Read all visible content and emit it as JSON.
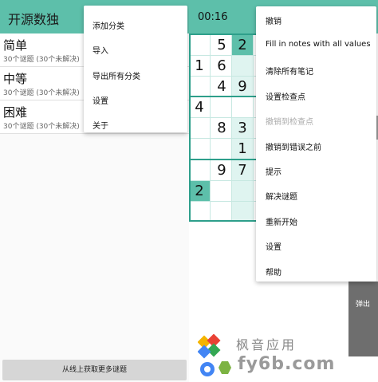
{
  "left_panel": {
    "title": "开源数独",
    "categories": [
      {
        "name": "简单",
        "sub": "30个谜题 (30个未解决)"
      },
      {
        "name": "中等",
        "sub": "30个谜题 (30个未解决)"
      },
      {
        "name": "困难",
        "sub": "30个谜题 (30个未解决)"
      }
    ],
    "menu": [
      "添加分类",
      "导入",
      "导出所有分类",
      "设置",
      "关于"
    ],
    "get_more_button": "从线上获取更多谜题"
  },
  "right_panel": {
    "timer": "00:16",
    "board_rows": [
      [
        "",
        "5",
        "2"
      ],
      [
        "1",
        "6",
        ""
      ],
      [
        "",
        "4",
        "9"
      ],
      [
        "4",
        "",
        ""
      ],
      [
        "",
        "8",
        "3"
      ],
      [
        "",
        "",
        "1"
      ],
      [
        "",
        "9",
        "7"
      ],
      [
        "2",
        "",
        ""
      ],
      [
        "",
        "",
        ""
      ]
    ],
    "menu": [
      {
        "label": "撤销",
        "enabled": true
      },
      {
        "label": "Fill in notes with all values",
        "enabled": true
      },
      {
        "label": "清除所有笔记",
        "enabled": true
      },
      {
        "label": "设置检查点",
        "enabled": true
      },
      {
        "label": "撤销到检查点",
        "enabled": false
      },
      {
        "label": "撤销到错误之前",
        "enabled": true
      },
      {
        "label": "提示",
        "enabled": true
      },
      {
        "label": "解决谜题",
        "enabled": true
      },
      {
        "label": "重新开始",
        "enabled": true
      },
      {
        "label": "设置",
        "enabled": true
      },
      {
        "label": "帮助",
        "enabled": true
      }
    ],
    "popup_button": "弹出"
  },
  "watermark": {
    "text": "枫音应用",
    "url": "fy6b.com"
  },
  "colors": {
    "toolbar": "#5dbfaa",
    "grid_major": "#2e9f8b",
    "grid_minor": "#c7e8e1",
    "given_cell": "#5dbfaa",
    "highlight_cell": "#dff4f0"
  }
}
